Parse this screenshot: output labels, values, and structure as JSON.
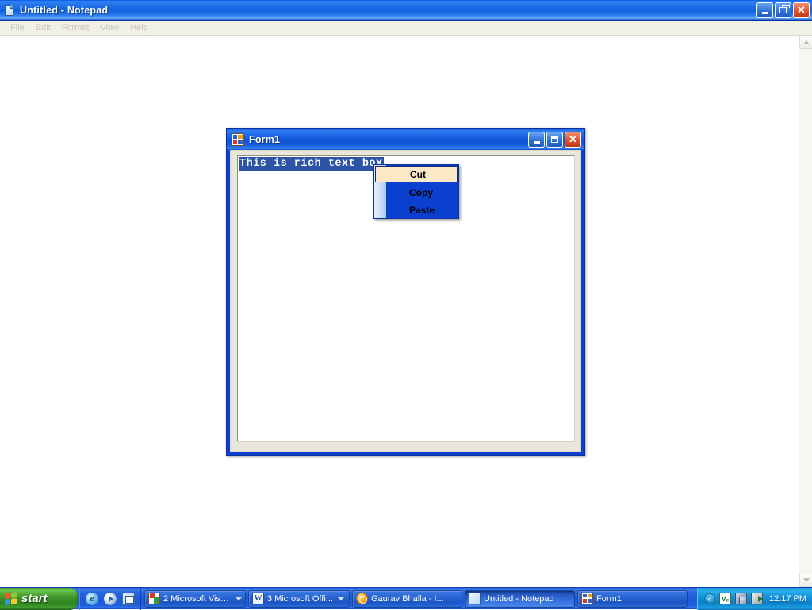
{
  "notepad": {
    "title": "Untitled - Notepad",
    "icon": "notepad-icon",
    "menus": [
      {
        "label": "File"
      },
      {
        "label": "Edit"
      },
      {
        "label": "Format"
      },
      {
        "label": "View"
      },
      {
        "label": "Help"
      }
    ],
    "document_text": "",
    "window_buttons": {
      "minimize": "Minimize",
      "restore": "Restore",
      "close": "Close"
    },
    "scrollbar": {
      "up_label": "Scroll up",
      "down_label": "Scroll down"
    }
  },
  "form1": {
    "title": "Form1",
    "icon": "winforms-icon",
    "window_buttons": {
      "minimize": "Minimize",
      "maximize": "Maximize",
      "close": "Close"
    },
    "richtextbox": {
      "text": "This is rich text box",
      "selected": true
    }
  },
  "context_menu": {
    "items": [
      {
        "label": "Cut",
        "selected": true
      },
      {
        "label": "Copy",
        "selected": false
      },
      {
        "label": "Paste",
        "selected": false
      }
    ]
  },
  "taskbar": {
    "start_label": "start",
    "quick_launch": [
      {
        "name": "internet-explorer-icon",
        "glyph": "e"
      },
      {
        "name": "windows-media-player-icon",
        "glyph": ""
      },
      {
        "name": "show-desktop-icon",
        "glyph": ""
      }
    ],
    "buttons": [
      {
        "label": "2 Microsoft Visu...",
        "icon": "visual-studio-icon",
        "grouped": true,
        "active": false
      },
      {
        "label": "3 Microsoft Offi...",
        "icon": "word-icon",
        "grouped": true,
        "active": false
      },
      {
        "label": "Gaurav Bhalla - I...",
        "icon": "messenger-icon",
        "grouped": false,
        "active": false
      },
      {
        "label": "Untitled - Notepad",
        "icon": "notepad-icon",
        "grouped": false,
        "active": true
      },
      {
        "label": "Form1",
        "icon": "winforms-icon",
        "grouped": false,
        "active": false
      }
    ],
    "tray": {
      "chevron": "«",
      "icons": [
        {
          "name": "antivirus-icon",
          "glyph": "Vₑ"
        },
        {
          "name": "network-connection-icon",
          "glyph": ""
        },
        {
          "name": "volume-icon",
          "glyph": ""
        }
      ],
      "clock": "12:17 PM"
    }
  },
  "colors": {
    "titlebar_blue": "#1a6ae4",
    "menu_blue": "#0a3fd0",
    "menu_highlight": "#fbe8c6",
    "selection_blue": "#2c53a6",
    "form_border": "#0a41cf",
    "taskbar_blue": "#2a68e0",
    "start_green": "#40962a"
  }
}
